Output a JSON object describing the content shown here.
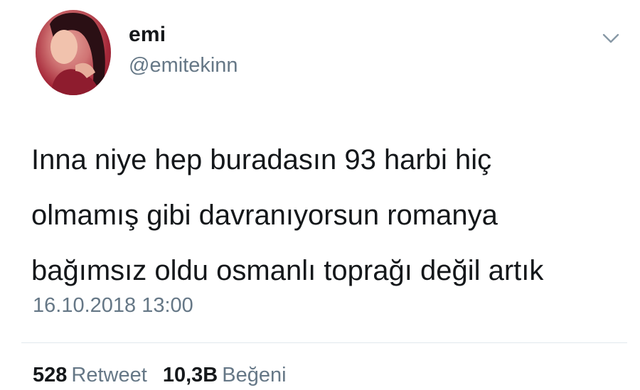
{
  "user": {
    "display_name": "emi",
    "handle": "@emitekinn"
  },
  "tweet": {
    "text": "Inna niye hep buradasın 93 harbi hiç\nolmamış gibi davranıyorsun romanya\nbağımsız oldu osmanlı toprağı değil artık",
    "timestamp": "16.10.2018 13:00"
  },
  "stats": {
    "retweets": {
      "count": "528",
      "label": "Retweet"
    },
    "likes": {
      "count": "10,3B",
      "label": "Beğeni"
    }
  },
  "icons": {
    "menu": "chevron-down-icon"
  },
  "colors": {
    "text": "#14171a",
    "secondary": "#657786",
    "divider": "#e1e8ed"
  }
}
